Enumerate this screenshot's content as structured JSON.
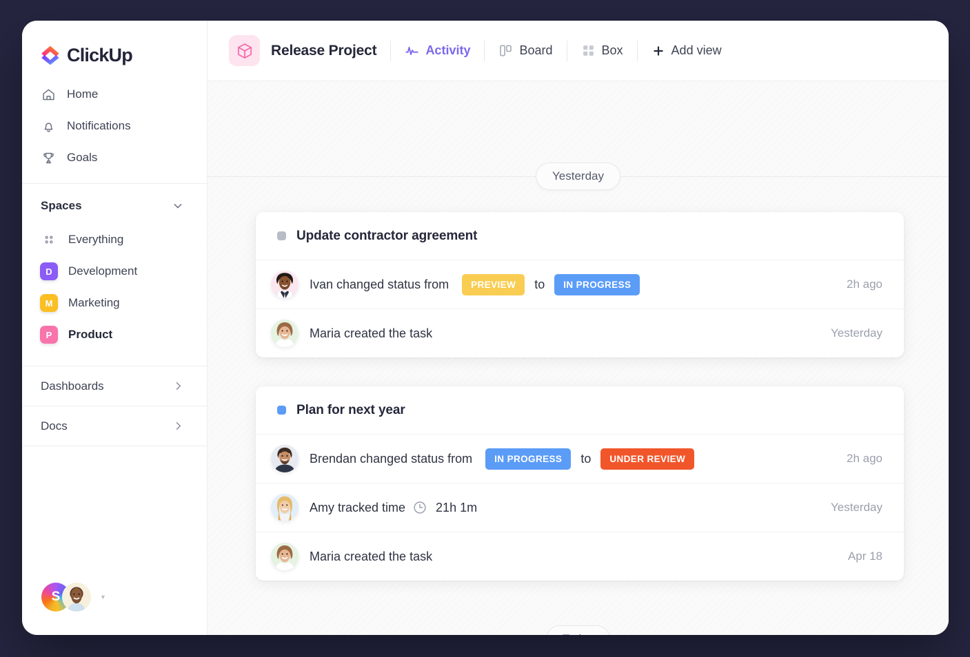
{
  "theme": {
    "page_background": "#252540",
    "accent_purple": "#7b68ee",
    "card_background": "#ffffff"
  },
  "sidebar": {
    "logo": {
      "word": "ClickUp",
      "icon": "clickup-logo-icon"
    },
    "nav": [
      {
        "label": "Home",
        "icon": "home-icon"
      },
      {
        "label": "Notifications",
        "icon": "bell-icon"
      },
      {
        "label": "Goals",
        "icon": "trophy-icon"
      }
    ],
    "spaces": {
      "title": "Spaces",
      "collapse_icon": "chevron-down-icon",
      "items": [
        {
          "label": "Everything",
          "icon": "dots-grid-icon",
          "initial": "",
          "color": "",
          "active": false
        },
        {
          "label": "Development",
          "icon": "space-badge",
          "initial": "D",
          "color": "#8b5cf6",
          "active": false
        },
        {
          "label": "Marketing",
          "icon": "space-badge",
          "initial": "M",
          "color": "#fbbf24",
          "active": false
        },
        {
          "label": "Product",
          "icon": "space-badge",
          "initial": "P",
          "color": "#f874ab",
          "active": true
        }
      ]
    },
    "sections": [
      {
        "label": "Dashboards",
        "icon": "chevron-right-icon"
      },
      {
        "label": "Docs",
        "icon": "chevron-right-icon"
      }
    ],
    "footer": {
      "workspace_initial": "S",
      "workspace_icon": "workspace-avatar",
      "user_icon": "user-avatar",
      "caret_icon": "caret-down-icon"
    }
  },
  "header": {
    "project_icon": "cube-icon",
    "project_title": "Release Project",
    "tabs": [
      {
        "label": "Activity",
        "icon": "activity-pulse-icon",
        "active": true
      },
      {
        "label": "Board",
        "icon": "board-columns-icon",
        "active": false
      },
      {
        "label": "Box",
        "icon": "box-grid-icon",
        "active": false
      },
      {
        "label": "Add view",
        "icon": "plus-icon",
        "active": false
      }
    ]
  },
  "feed": {
    "separator_top": "Yesterday",
    "separator_bottom": "Today",
    "cards": [
      {
        "task_name": "Update contractor agreement",
        "task_dot_color": "#b7bcc6",
        "rows": [
          {
            "kind": "status-change",
            "avatar": "avatar-ivan",
            "text": "Ivan changed status from",
            "from_status": {
              "label": "PREVIEW",
              "color": "#f9cd52"
            },
            "connector": "to",
            "to_status": {
              "label": "IN PROGRESS",
              "color": "#5b9cf7"
            },
            "time": "2h ago"
          },
          {
            "kind": "created",
            "avatar": "avatar-maria",
            "text": "Maria created the task",
            "time": "Yesterday"
          }
        ]
      },
      {
        "task_name": "Plan for next year",
        "task_dot_color": "#5b9cf7",
        "rows": [
          {
            "kind": "status-change",
            "avatar": "avatar-brendan",
            "text": "Brendan changed status from",
            "from_status": {
              "label": "IN PROGRESS",
              "color": "#5b9cf7"
            },
            "connector": "to",
            "to_status": {
              "label": "UNDER REVIEW",
              "color": "#f1562a"
            },
            "time": "2h ago"
          },
          {
            "kind": "time-tracked",
            "avatar": "avatar-amy",
            "text": "Amy tracked time",
            "clock_icon": "clock-icon",
            "duration": "21h 1m",
            "time": "Yesterday"
          },
          {
            "kind": "created",
            "avatar": "avatar-maria",
            "text": "Maria created the task",
            "time": "Apr 18"
          }
        ]
      }
    ]
  }
}
